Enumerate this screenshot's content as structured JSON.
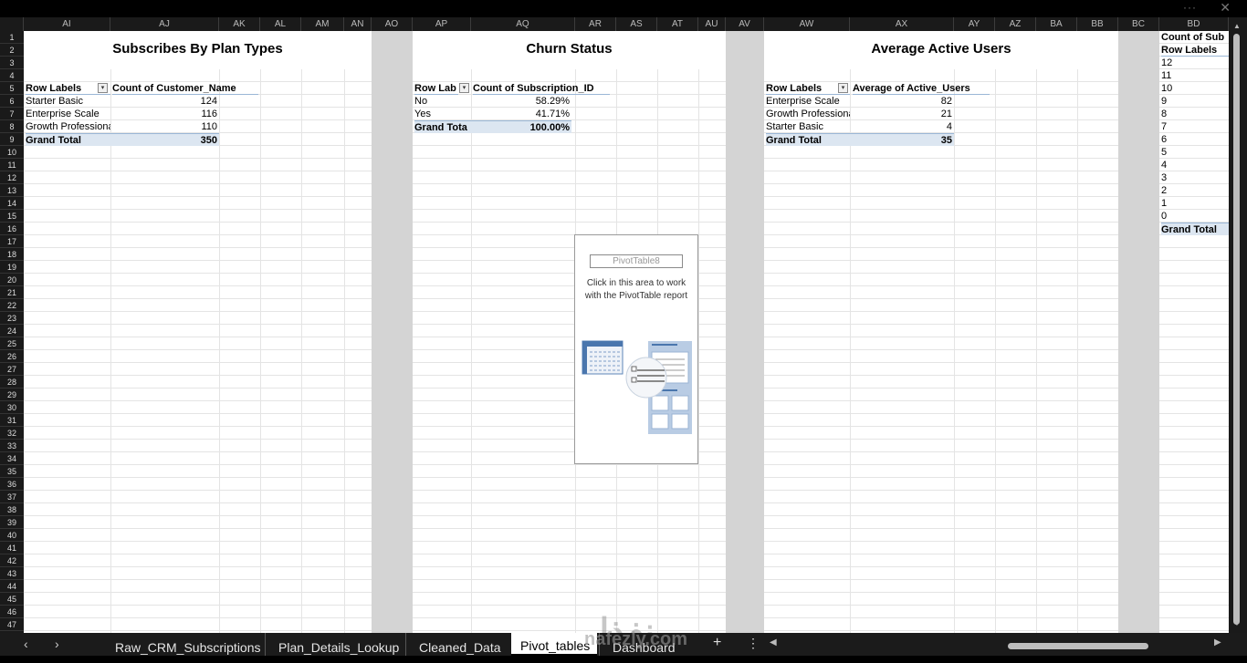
{
  "window": {
    "more_glyph": "···",
    "close_glyph": "✕"
  },
  "column_headers": [
    "AI",
    "AJ",
    "AK",
    "AL",
    "AM",
    "AN",
    "AO",
    "AP",
    "AQ",
    "AR",
    "AS",
    "AT",
    "AU",
    "AV",
    "AW",
    "AX",
    "AY",
    "AZ",
    "BA",
    "BB",
    "BC",
    "BD"
  ],
  "row_numbers": [
    "1",
    "2",
    "3",
    "4",
    "5",
    "6",
    "7",
    "8",
    "9",
    "10",
    "11",
    "12",
    "13",
    "14",
    "15",
    "16",
    "17",
    "18",
    "19",
    "20",
    "21",
    "22",
    "23",
    "24",
    "25",
    "26",
    "27",
    "28",
    "29",
    "30",
    "31",
    "32",
    "33",
    "34",
    "35",
    "36",
    "37",
    "38",
    "39",
    "40",
    "41",
    "42",
    "43",
    "44",
    "45",
    "46",
    "47"
  ],
  "pivot_plan": {
    "title": "Subscribes By Plan Types",
    "header": [
      "Row Labels",
      "Count of Customer_Name"
    ],
    "rows": [
      {
        "label": "Starter Basic",
        "value": "124"
      },
      {
        "label": "Enterprise Scale",
        "value": "116"
      },
      {
        "label": "Growth Professiona",
        "value": "110"
      }
    ],
    "total": {
      "label": "Grand Total",
      "value": "350"
    }
  },
  "pivot_churn": {
    "title": "Churn Status",
    "header": [
      "Row Lab",
      "Count of Subscription_ID"
    ],
    "rows": [
      {
        "label": "No",
        "value": "58.29%"
      },
      {
        "label": "Yes",
        "value": "41.71%"
      }
    ],
    "total": {
      "label": "Grand Tota",
      "value": "100.00%"
    }
  },
  "pivot_active": {
    "title": "Average Active Users",
    "header": [
      "Row Labels",
      "Average of Active_Users"
    ],
    "rows": [
      {
        "label": "Enterprise Scale",
        "value": "82"
      },
      {
        "label": "Growth Professiona",
        "value": "21"
      },
      {
        "label": "Starter Basic",
        "value": "4"
      }
    ],
    "total": {
      "label": "Grand Total",
      "value": "35"
    }
  },
  "pivot_partial": {
    "header_top": "Count of Sub",
    "header": "Row Labels",
    "rows": [
      "12",
      "11",
      "10",
      "9",
      "8",
      "7",
      "6",
      "5",
      "4",
      "3",
      "2",
      "1",
      "0"
    ],
    "total": "Grand Total"
  },
  "empty_pivot": {
    "name": "PivotTable8",
    "message": "Click in this area to work with the PivotTable report"
  },
  "sheet_tabs": [
    {
      "label": "Raw_CRM_Subscriptions"
    },
    {
      "label": "Plan_Details_Lookup"
    },
    {
      "label": "Cleaned_Data"
    },
    {
      "label": "Pivot_tables"
    },
    {
      "label": "Dashboard"
    }
  ],
  "tab_nav": {
    "prev": "‹",
    "next": "›",
    "add": "+",
    "more": "⋮"
  },
  "scroll_glyphs": {
    "up": "▲",
    "down": "▼",
    "left": "◀",
    "right": "▶"
  },
  "watermark": {
    "text": "نفذلي",
    "domain": "nafezly.com"
  },
  "icons": [
    "more-icon",
    "close-icon",
    "filter-dropdown-icon",
    "pivot-illustration-icon",
    "scroll-arrow-icon"
  ]
}
